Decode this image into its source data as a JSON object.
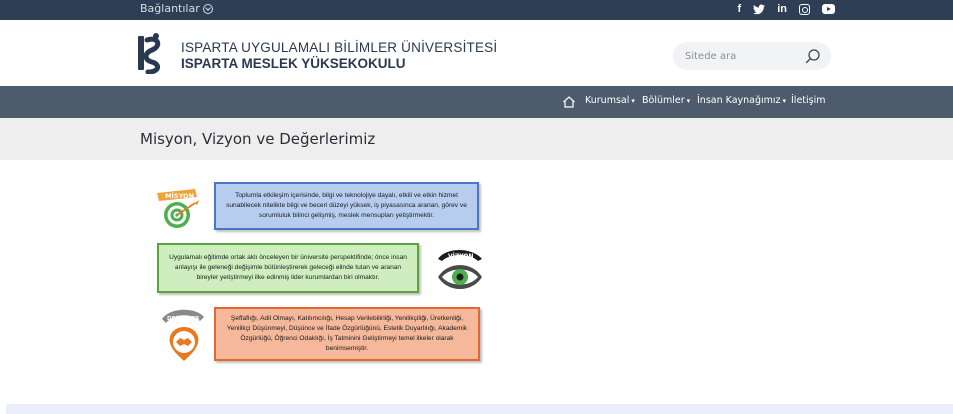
{
  "topbar": {
    "links_label": "Bağlantılar",
    "social": [
      "facebook-icon",
      "twitter-icon",
      "linkedin-icon",
      "instagram-icon",
      "youtube-icon"
    ],
    "facebook_glyph": "f",
    "linkedin_glyph": "in"
  },
  "header": {
    "university": "ISPARTA UYGULAMALI BİLİMLER ÜNİVERSİTESİ",
    "school": "ISPARTA MESLEK YÜKSEKOKULU"
  },
  "search": {
    "placeholder": "Sitede ara"
  },
  "nav": {
    "items": [
      {
        "label": "Kurumsal",
        "has_dropdown": true
      },
      {
        "label": "Bölümler",
        "has_dropdown": true
      },
      {
        "label": "İnsan Kaynağımız",
        "has_dropdown": true
      },
      {
        "label": "İletişim",
        "has_dropdown": false
      }
    ]
  },
  "page": {
    "title": "Misyon, Vizyon ve Değerlerimiz"
  },
  "infographic": {
    "mission": {
      "badge": "MİSYON",
      "text": "Toplumla etkileşim içerisinde, bilgi ve teknolojiye dayalı, etkili ve etkin hizmet sunabilecek nitelikte bilgi ve beceri düzeyi yüksek, iş piyasasınca aranan, görev ve sorumluluk bilinci gelişmiş, meslek mensupları yetiştirmektir."
    },
    "vision": {
      "badge": "VİZYON",
      "text": "Uygulamalı eğitimde ortak aklı önceleyen bir üniversite perspektifinde; önce insan anlayışı ile geleneği değişimle bütünleştirerek geleceği elinde tutan ve aranan bireyler yetiştirmeyi ilke edinmiş lider kurumlardan biri olmaktır."
    },
    "values": {
      "badge": "DEĞERLER",
      "text": "Şeffaflığı, Adil Olmayı, Katılımcılığı, Hesap Verilebilirliği, Yenilikçiliği, Üretkenliği, Yenilikçi Düşünmeyi, Düşünce ve İfade Özgürlüğünü, Estetik Duyarlılığı, Akademik Özgürlüğü, Öğrenci Odaklığı, İş Tatminini Geliştirmeyi temel ilkeler olarak benimsemiştir."
    }
  },
  "colors": {
    "topbar": "#2d3e55",
    "nav": "#4d5b6c",
    "title_band": "#eeeeee",
    "mission_box": "#b7cdf0",
    "vision_box": "#cfeec0",
    "values_box": "#f6b89a",
    "accent_green": "#4caf50",
    "accent_orange": "#e8791f"
  }
}
